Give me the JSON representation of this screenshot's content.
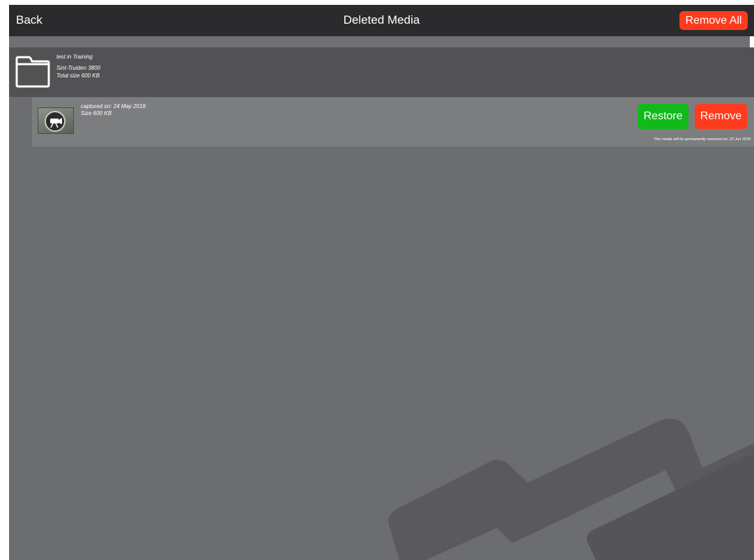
{
  "navbar": {
    "back_label": "Back",
    "title": "Deleted Media",
    "remove_all_label": "Remove All"
  },
  "folder": {
    "name": "test in Training",
    "location": "Sint-Truiden   3800",
    "total_size": "Total size 600 KB"
  },
  "media_item": {
    "captured": "captured on: 24 May 2018",
    "size": "Size 600 KB",
    "restore_label": "Restore",
    "remove_label": "Remove",
    "removal_note": "This media will be permanently removed on:  23 Jun 2018"
  },
  "colors": {
    "background": "#6c6d71",
    "navbar": "#2b2b2e",
    "destructive": "#ff3b1d",
    "restore": "#0fba1a"
  },
  "icons": [
    "folder-icon",
    "video-camera-icon",
    "folder-watermark-icon"
  ]
}
